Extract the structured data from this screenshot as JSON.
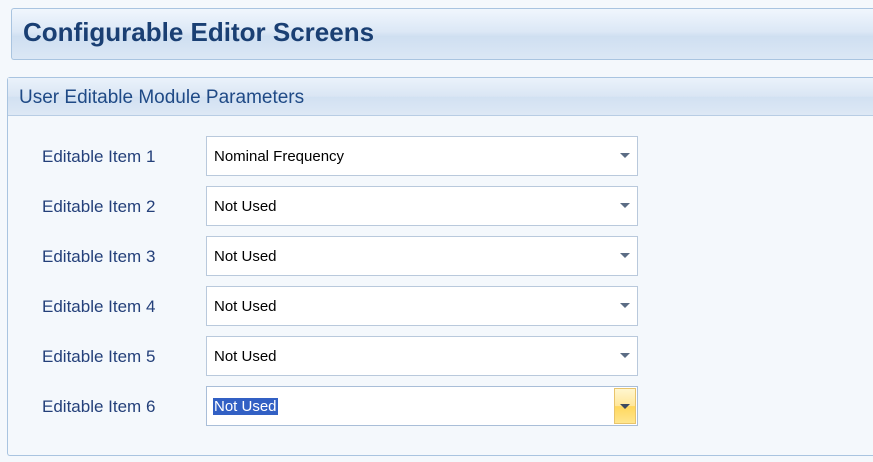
{
  "title": "Configurable Editor Screens",
  "group": {
    "header": "User Editable Module Parameters",
    "rows": [
      {
        "label": "Editable Item 1",
        "value": "Nominal Frequency"
      },
      {
        "label": "Editable Item 2",
        "value": "Not Used"
      },
      {
        "label": "Editable Item 3",
        "value": "Not Used"
      },
      {
        "label": "Editable Item 4",
        "value": "Not Used"
      },
      {
        "label": "Editable Item 5",
        "value": "Not Used"
      },
      {
        "label": "Editable Item 6",
        "value": "Not Used"
      }
    ]
  },
  "icons": {
    "dropdown": "chevron-down-icon"
  },
  "colors": {
    "title_text": "#1a3f73",
    "header_text": "#1f4a86",
    "label_text": "#24407a",
    "selection_highlight": "#3260c4",
    "focused_arrow": "#ffd75c"
  }
}
